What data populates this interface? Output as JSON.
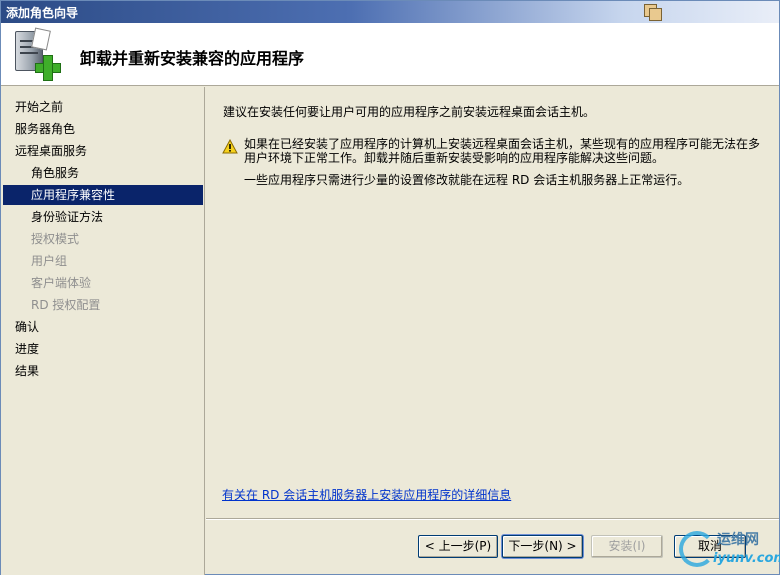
{
  "window": {
    "title": "添加角色向导"
  },
  "header": {
    "title": "卸载并重新安装兼容的应用程序"
  },
  "sidebar": {
    "items": [
      {
        "label": "开始之前",
        "level": 1,
        "state": "normal"
      },
      {
        "label": "服务器角色",
        "level": 1,
        "state": "normal"
      },
      {
        "label": "远程桌面服务",
        "level": 1,
        "state": "normal"
      },
      {
        "label": "角色服务",
        "level": 2,
        "state": "normal"
      },
      {
        "label": "应用程序兼容性",
        "level": 2,
        "state": "selected"
      },
      {
        "label": "身份验证方法",
        "level": 2,
        "state": "normal"
      },
      {
        "label": "授权模式",
        "level": 2,
        "state": "disabled"
      },
      {
        "label": "用户组",
        "level": 2,
        "state": "disabled"
      },
      {
        "label": "客户端体验",
        "level": 2,
        "state": "disabled"
      },
      {
        "label": "RD 授权配置",
        "level": 2,
        "state": "disabled"
      },
      {
        "label": "确认",
        "level": 1,
        "state": "normal"
      },
      {
        "label": "进度",
        "level": 1,
        "state": "normal"
      },
      {
        "label": "结果",
        "level": 1,
        "state": "normal"
      }
    ]
  },
  "content": {
    "intro": "建议在安装任何要让用户可用的应用程序之前安装远程桌面会话主机。",
    "warning": "如果在已经安装了应用程序的计算机上安装远程桌面会话主机，某些现有的应用程序可能无法在多用户环境下正常工作。卸载并随后重新安装受影响的应用程序能解决这些问题。",
    "note": "一些应用程序只需进行少量的设置修改就能在远程 RD 会话主机服务器上正常运行。",
    "link": "有关在 RD 会话主机服务器上安装应用程序的详细信息"
  },
  "buttons": {
    "prev": "< 上一步(P)",
    "next": "下一步(N) >",
    "install": "安装(I)",
    "cancel": "取消"
  },
  "watermark": {
    "top": "运维网",
    "bottom": "iyunv.com"
  },
  "colors": {
    "selection": "#0a246a",
    "link": "#0033cc",
    "titlebar_start": "#2c4b86"
  }
}
